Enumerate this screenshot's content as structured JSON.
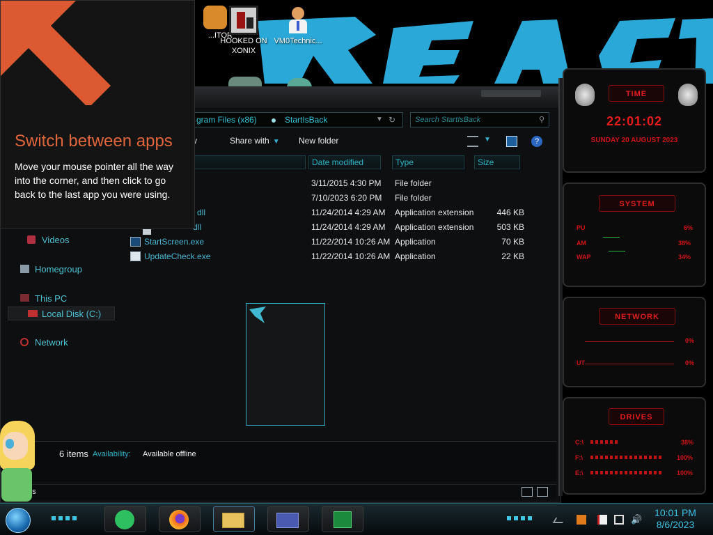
{
  "desktop": {
    "wallpaper_text": "REACT",
    "icons": [
      {
        "label": "...ITOR"
      },
      {
        "label": "HOOKED ON XONIX"
      },
      {
        "label": "VM0Technic..."
      }
    ]
  },
  "tooltip": {
    "title": "Switch between apps",
    "body": "Move your mouse pointer all the way into the corner, and then click to go back to the last app you were using."
  },
  "explorer": {
    "address": {
      "segment1": "gram Files (x86)",
      "segment2": "StartIsBack"
    },
    "search": {
      "placeholder": "Search StartIsBack"
    },
    "commands": {
      "organize": "y",
      "share_with": "Share with",
      "new_folder": "New folder"
    },
    "columns": {
      "name": "",
      "date_modified": "Date modified",
      "type": "Type",
      "size": "Size"
    },
    "files": [
      {
        "name": "",
        "date": "3/11/2015 4:30 PM",
        "type": "File folder",
        "size": ""
      },
      {
        "name": "",
        "date": "7/10/2023 6:20 PM",
        "type": "File folder",
        "size": ""
      },
      {
        "name": "dll",
        "date": "11/24/2014 4:29 AM",
        "type": "Application extension",
        "size": "446 KB"
      },
      {
        "name": "dll",
        "date": "11/24/2014 4:29 AM",
        "type": "Application extension",
        "size": "503 KB"
      },
      {
        "name": "StartScreen.exe",
        "date": "11/22/2014 10:26 AM",
        "type": "Application",
        "size": "70 KB"
      },
      {
        "name": "UpdateCheck.exe",
        "date": "11/22/2014 10:26 AM",
        "type": "Application",
        "size": "22 KB"
      }
    ],
    "nav": {
      "videos": "Videos",
      "homegroup": "Homegroup",
      "this_pc": "This PC",
      "local_disk": "Local Disk (C:)",
      "network": "Network"
    },
    "status": {
      "count": "6 items",
      "availability_label": "Availability:",
      "availability_value": "Available offline",
      "bottom_items": "ems"
    }
  },
  "gadgets": {
    "time": {
      "title": "TIME",
      "clock": "22:01:02",
      "date": "SUNDAY 20 AUGUST 2023"
    },
    "system": {
      "title": "SYSTEM",
      "rows": [
        {
          "label": "PU",
          "value": "6%"
        },
        {
          "label": "AM",
          "value": "38%"
        },
        {
          "label": "WAP",
          "value": "34%"
        }
      ]
    },
    "network": {
      "title": "NETWORK",
      "rows": [
        {
          "label": "",
          "value": "0%"
        },
        {
          "label": "UT",
          "value": "0%"
        }
      ]
    },
    "drives": {
      "title": "DRIVES",
      "rows": [
        {
          "label": "C:\\",
          "value": "38%"
        },
        {
          "label": "F:\\",
          "value": "100%"
        },
        {
          "label": "E:\\",
          "value": "100%"
        }
      ]
    }
  },
  "taskbar": {
    "time": "10:01 PM",
    "date": "8/6/2023"
  },
  "colors": {
    "accent_cyan": "#34c6d6",
    "tooltip_title": "#e2663b",
    "gadget_red": "#d21414"
  }
}
